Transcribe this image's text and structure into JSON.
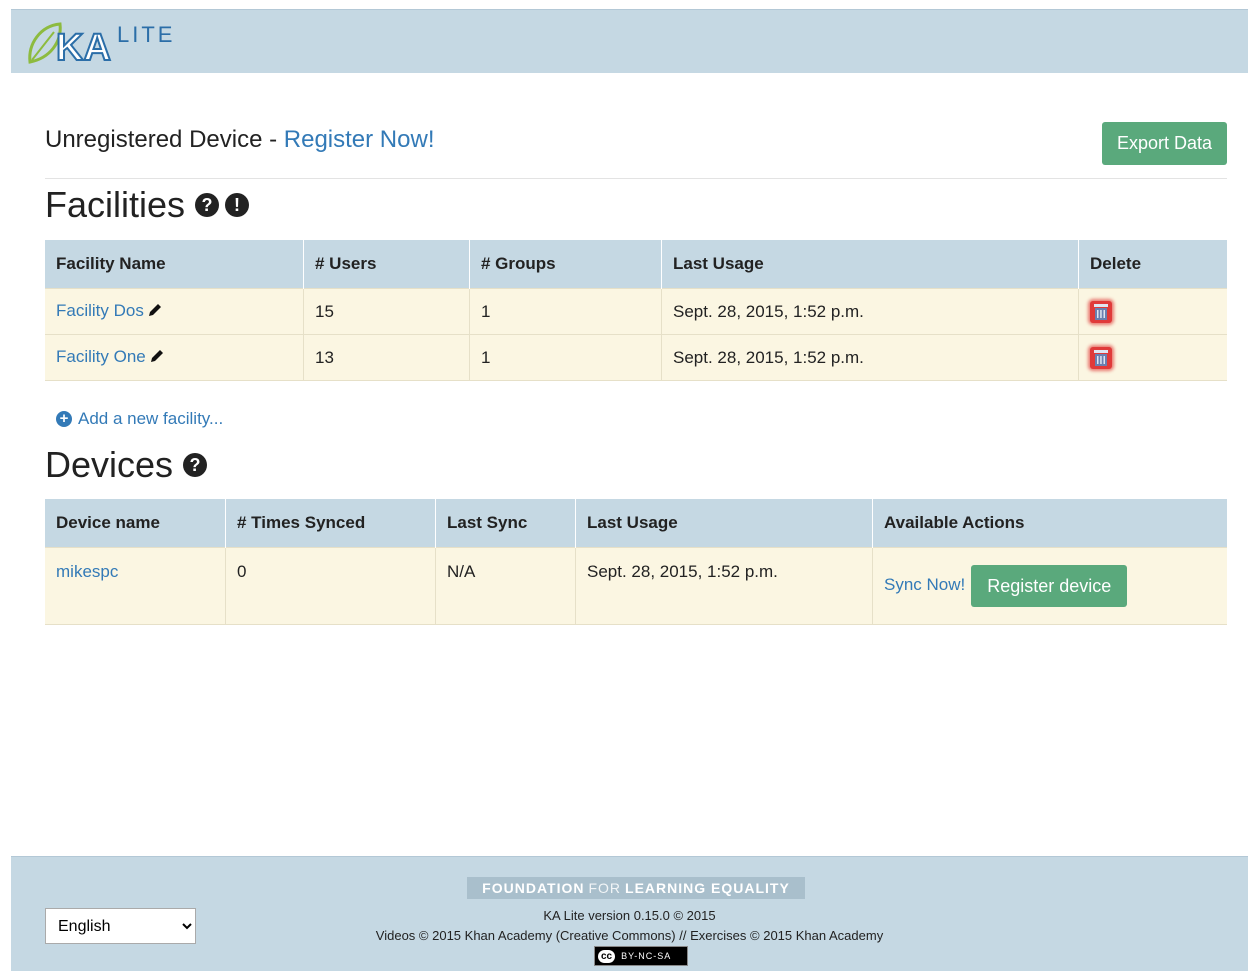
{
  "header": {
    "logo_text": "LITE"
  },
  "registration": {
    "prefix": "Unregistered Device - ",
    "link": "Register Now!"
  },
  "export_button": "Export Data",
  "facilities": {
    "title": "Facilities",
    "columns": [
      "Facility Name",
      "# Users",
      "# Groups",
      "Last Usage",
      "Delete"
    ],
    "rows": [
      {
        "name": "Facility Dos",
        "users": "15",
        "groups": "1",
        "last_usage": "Sept. 28, 2015, 1:52 p.m."
      },
      {
        "name": "Facility One",
        "users": "13",
        "groups": "1",
        "last_usage": "Sept. 28, 2015, 1:52 p.m."
      }
    ],
    "add_link": "Add a new facility..."
  },
  "devices": {
    "title": "Devices",
    "columns": [
      "Device name",
      "# Times Synced",
      "Last Sync",
      "Last Usage",
      "Available Actions"
    ],
    "rows": [
      {
        "name": "mikespc",
        "times_synced": "0",
        "last_sync": "N/A",
        "last_usage": "Sept. 28, 2015, 1:52 p.m.",
        "sync_link": "Sync Now!",
        "register_button": "Register device"
      }
    ]
  },
  "footer": {
    "language": "English",
    "fle_part1": "FOUNDATION",
    "fle_part2": "FOR",
    "fle_part3": "LEARNING EQUALITY",
    "version": "KA Lite version 0.15.0 © 2015",
    "credits": "Videos © 2015 Khan Academy (Creative Commons) // Exercises © 2015 Khan Academy",
    "cc_badge": "cc",
    "license": "BY-NC-SA"
  },
  "colors": {
    "accent": "#337ab7",
    "button_green": "#5aa97c",
    "header_bg": "#c5d8e3",
    "row_bg": "#fbf6e2"
  }
}
